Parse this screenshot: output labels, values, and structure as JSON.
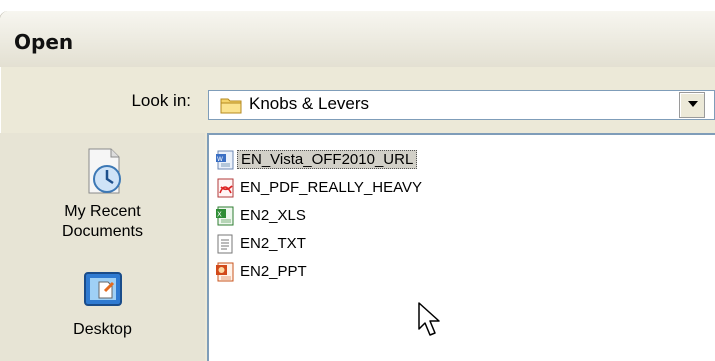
{
  "window": {
    "title": "Open"
  },
  "look_in": {
    "label": "Look in:",
    "value": "Knobs & Levers"
  },
  "places": [
    {
      "label_line1": "My Recent",
      "label_line2": "Documents",
      "icon": "recent-documents-icon"
    },
    {
      "label_line1": "Desktop",
      "label_line2": "",
      "icon": "desktop-icon"
    }
  ],
  "files": [
    {
      "name": "EN_Vista_OFF2010_URL",
      "icon": "word-document-icon",
      "selected": true
    },
    {
      "name": "EN_PDF_REALLY_HEAVY",
      "icon": "pdf-document-icon",
      "selected": false
    },
    {
      "name": "EN2_XLS",
      "icon": "excel-document-icon",
      "selected": false
    },
    {
      "name": "EN2_TXT",
      "icon": "text-document-icon",
      "selected": false
    },
    {
      "name": "EN2_PPT",
      "icon": "powerpoint-document-icon",
      "selected": false
    }
  ],
  "colors": {
    "dialog_bg": "#ece9d8",
    "border": "#7f9db9",
    "selection": "#d2d0c8"
  }
}
